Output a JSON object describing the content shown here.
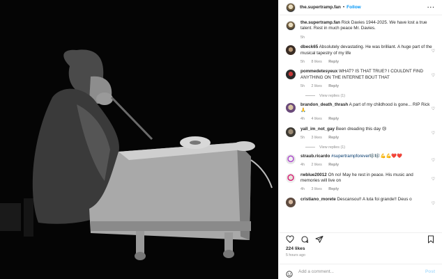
{
  "header": {
    "username": "the.supertramp.fan",
    "separator": "•",
    "follow_label": "Follow",
    "more_label": "···"
  },
  "caption": {
    "username": "the.supertramp.fan",
    "text": "Rick Davies 1944-2025. We have lost a true talent. Rest in much peace Mr. Davies.",
    "time": "5h"
  },
  "comments": [
    {
      "username": "dbeck65",
      "text": "Absolutely devastating. He was brilliant. A huge part of the musical tapestry of my life",
      "time": "5h",
      "likes": "8 likes",
      "reply": "Reply"
    },
    {
      "username": "pommedetesyeux",
      "text": "WHAT? IS THAT TRUE? I COULDNT FIND ANYTHING ON THE INTERNET BOUT THAT",
      "time": "5h",
      "likes": "2 likes",
      "reply": "Reply",
      "view_replies": "View replies (1)"
    },
    {
      "username": "brandon_death_thrash",
      "text": "A part of my childhood is gone... RIP Rick 🙏",
      "time": "4h",
      "likes": "4 likes",
      "reply": "Reply"
    },
    {
      "username": "yall_im_not_gay",
      "text": "Been dreading this day 😢",
      "time": "5h",
      "likes": "3 likes",
      "reply": "Reply",
      "view_replies": "View replies (1)"
    },
    {
      "username": "straub.ricardo",
      "hashtag": "#supertrampforever🎼🎼",
      "emoji": "💪💪❤️❤️",
      "time": "4h",
      "likes": "2 likes",
      "reply": "Reply"
    },
    {
      "username": "rwblue20012",
      "text": "Oh no! May he rest in peace. His music and memories will live on",
      "time": "4h",
      "likes": "3 likes",
      "reply": "Reply"
    },
    {
      "username": "cristiano_morete",
      "text": "Descansou!! A luta foi grande!! Deus o",
      "time": "",
      "likes": "",
      "reply": ""
    }
  ],
  "actions": {
    "likes": "224 likes",
    "time": "5 hours ago"
  },
  "add_comment": {
    "placeholder": "Add a comment...",
    "post_label": "Post"
  }
}
